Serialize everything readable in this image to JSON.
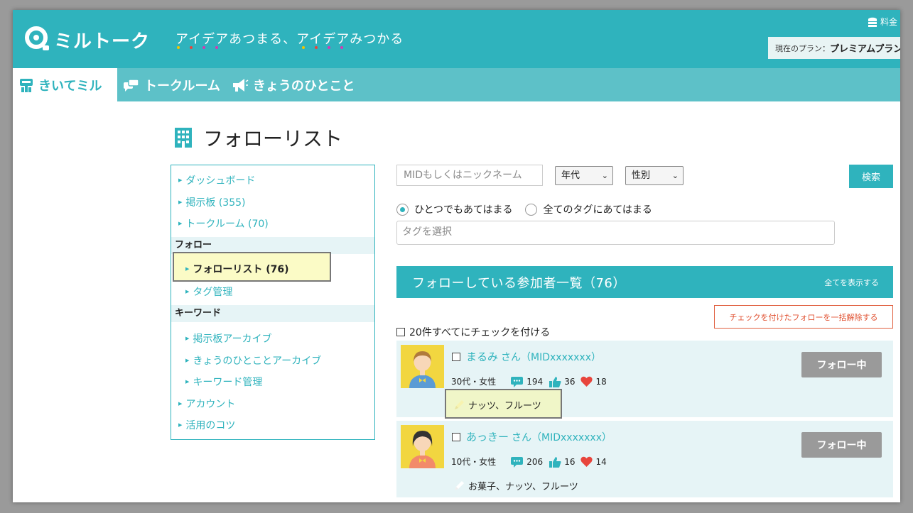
{
  "header": {
    "logo_text": "ミルトーク",
    "tagline": "アイデアあつまる、アイデアみつかる",
    "fee_label": "料金",
    "plan_label": "現在のプラン：",
    "plan_value": "プレミアムプラン",
    "dot_colors": [
      "#f2c500",
      "#e8453c",
      "#d23bb3",
      "#d23bb3"
    ]
  },
  "nav": {
    "tabs": [
      {
        "label": "きいてミル",
        "icon": "signboard-icon",
        "active": true
      },
      {
        "label": "トークルーム",
        "icon": "chat-bubbles-icon",
        "active": false
      },
      {
        "label": "きょうのひとこと",
        "icon": "megaphone-icon",
        "active": false
      }
    ]
  },
  "page": {
    "title": "フォローリスト"
  },
  "sidebar": {
    "items_top": [
      "ダッシュボード",
      "掲示板 (355)",
      "トークルーム (70)"
    ],
    "section_follow": "フォロー",
    "follow_items": [
      "フォローリスト (76)",
      "タグ管理"
    ],
    "section_keyword": "キーワード",
    "keyword_items": [
      "掲示板アーカイブ",
      "きょうのひとことアーカイブ",
      "キーワード管理"
    ],
    "items_bottom": [
      "アカウント",
      "活用のコツ"
    ]
  },
  "search": {
    "mid_placeholder": "MIDもしくはニックネーム",
    "age_select": "年代",
    "gender_select": "性別",
    "button": "検索",
    "radio_any": "ひとつでもあてはまる",
    "radio_all": "全てのタグにあてはまる",
    "tag_placeholder": "タグを選択"
  },
  "list": {
    "title": "フォローしている参加者一覧（76）",
    "show_all": "全てを表示する",
    "bulk_unfollow": "チェックを付けたフォローを一括解除する",
    "check_all": "20件すべてにチェックを付ける",
    "members": [
      {
        "name": "まるみ",
        "suffix": "さん（MIDxxxxxxx）",
        "profile": "30代・女性",
        "posts": "194",
        "likes": "36",
        "hearts": "18",
        "tags": "ナッツ、フルーツ",
        "follow_label": "フォロー中",
        "avatar_bg": "#f2d640",
        "shirt": "#5b9bd5",
        "hair": "#b07a3c"
      },
      {
        "name": "あっきー",
        "suffix": "さん（MIDxxxxxxx）",
        "profile": "10代・女性",
        "posts": "206",
        "likes": "16",
        "hearts": "14",
        "tags": "お菓子、ナッツ、フルーツ",
        "follow_label": "フォロー中",
        "avatar_bg": "#f2d640",
        "shirt": "#f28a6a",
        "hair": "#333333"
      }
    ]
  }
}
